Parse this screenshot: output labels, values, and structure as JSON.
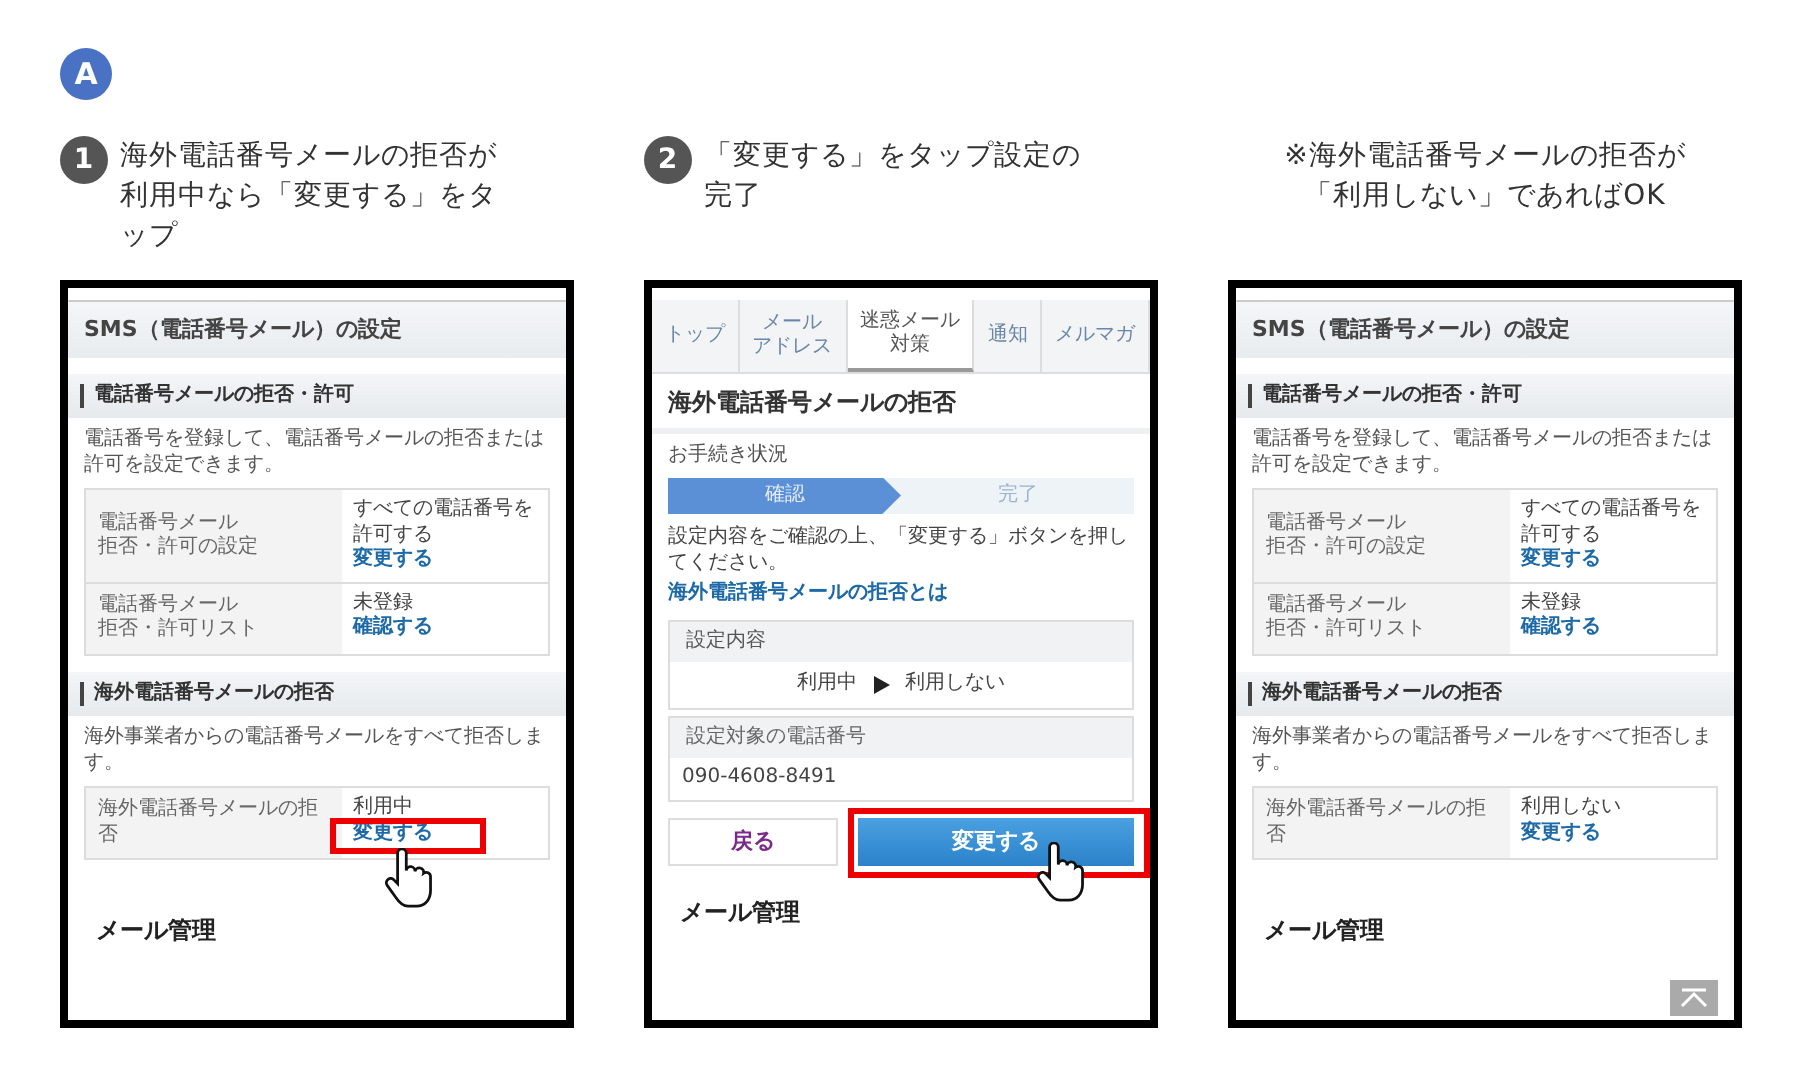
{
  "badge": "A",
  "steps": [
    {
      "kind": "step",
      "number": "1",
      "lines": [
        "海外電話番号メールの拒否が",
        "利用中なら「変更する」をタ",
        "ップ"
      ],
      "screen": {
        "kind": "settings",
        "title": "SMS（電話番号メール）の設定",
        "sections": [
          {
            "heading": "電話番号メールの拒否・許可",
            "description": "電話番号を登録して、電話番号メールの拒否または許可を設定できます。",
            "rows": [
              {
                "label_lines": [
                  "電話番号メール",
                  "拒否・許可の設定"
                ],
                "value": "すべての電話番号を許可する",
                "link": "変更する",
                "highlighted": false
              },
              {
                "label_lines": [
                  "電話番号メール",
                  "拒否・許可リスト"
                ],
                "value": "未登録",
                "link": "確認する",
                "highlighted": false
              }
            ]
          },
          {
            "heading": "海外電話番号メールの拒否",
            "description": "海外事業者からの電話番号メールをすべて拒否します。",
            "rows": [
              {
                "label_lines": [
                  "海外電話番号メールの拒否"
                ],
                "value": "利用中",
                "link": "変更する",
                "highlighted": true
              }
            ]
          }
        ],
        "footer_heading": "メール管理"
      }
    },
    {
      "kind": "step",
      "number": "2",
      "lines": [
        "「変更する」をタップ設定の",
        "完了"
      ],
      "screen": {
        "kind": "confirm",
        "tabs": [
          {
            "lines": [
              "トップ"
            ],
            "selected": false
          },
          {
            "lines": [
              "メール",
              "アドレス"
            ],
            "selected": false
          },
          {
            "lines": [
              "迷惑メール",
              "対策"
            ],
            "selected": true
          },
          {
            "lines": [
              "通知"
            ],
            "selected": false
          },
          {
            "lines": [
              "メルマガ"
            ],
            "selected": false
          }
        ],
        "title": "海外電話番号メールの拒否",
        "progress_label": "お手続き状況",
        "progress": [
          {
            "label": "確認",
            "selected": true
          },
          {
            "label": "完了",
            "selected": false
          }
        ],
        "instruction": "設定内容をご確認の上、「変更する」ボタンを押してください。",
        "help_link": "海外電話番号メールの拒否とは",
        "setting": {
          "heading": "設定内容",
          "from": "利用中",
          "to": "利用しない"
        },
        "phone": {
          "heading": "設定対象の電話番号",
          "value": "090-4608-8491"
        },
        "back_button": "戻る",
        "submit_button": {
          "label": "変更する",
          "highlighted": true
        },
        "footer_heading": "メール管理"
      }
    },
    {
      "kind": "note",
      "lines": [
        "※海外電話番号メールの拒否が",
        "「利用しない」であればOK"
      ],
      "screen": {
        "kind": "settings",
        "title": "SMS（電話番号メール）の設定",
        "sections": [
          {
            "heading": "電話番号メールの拒否・許可",
            "description": "電話番号を登録して、電話番号メールの拒否または許可を設定できます。",
            "rows": [
              {
                "label_lines": [
                  "電話番号メール",
                  "拒否・許可の設定"
                ],
                "value": "すべての電話番号を許可する",
                "link": "変更する",
                "highlighted": false
              },
              {
                "label_lines": [
                  "電話番号メール",
                  "拒否・許可リスト"
                ],
                "value": "未登録",
                "link": "確認する",
                "highlighted": false
              }
            ]
          },
          {
            "heading": "海外電話番号メールの拒否",
            "description": "海外事業者からの電話番号メールをすべて拒否します。",
            "rows": [
              {
                "label_lines": [
                  "海外電話番号メールの拒否"
                ],
                "value": "利用しない",
                "link": "変更する",
                "highlighted": false
              }
            ]
          }
        ],
        "footer_heading": "メール管理",
        "scroll_top_button": true
      }
    }
  ]
}
